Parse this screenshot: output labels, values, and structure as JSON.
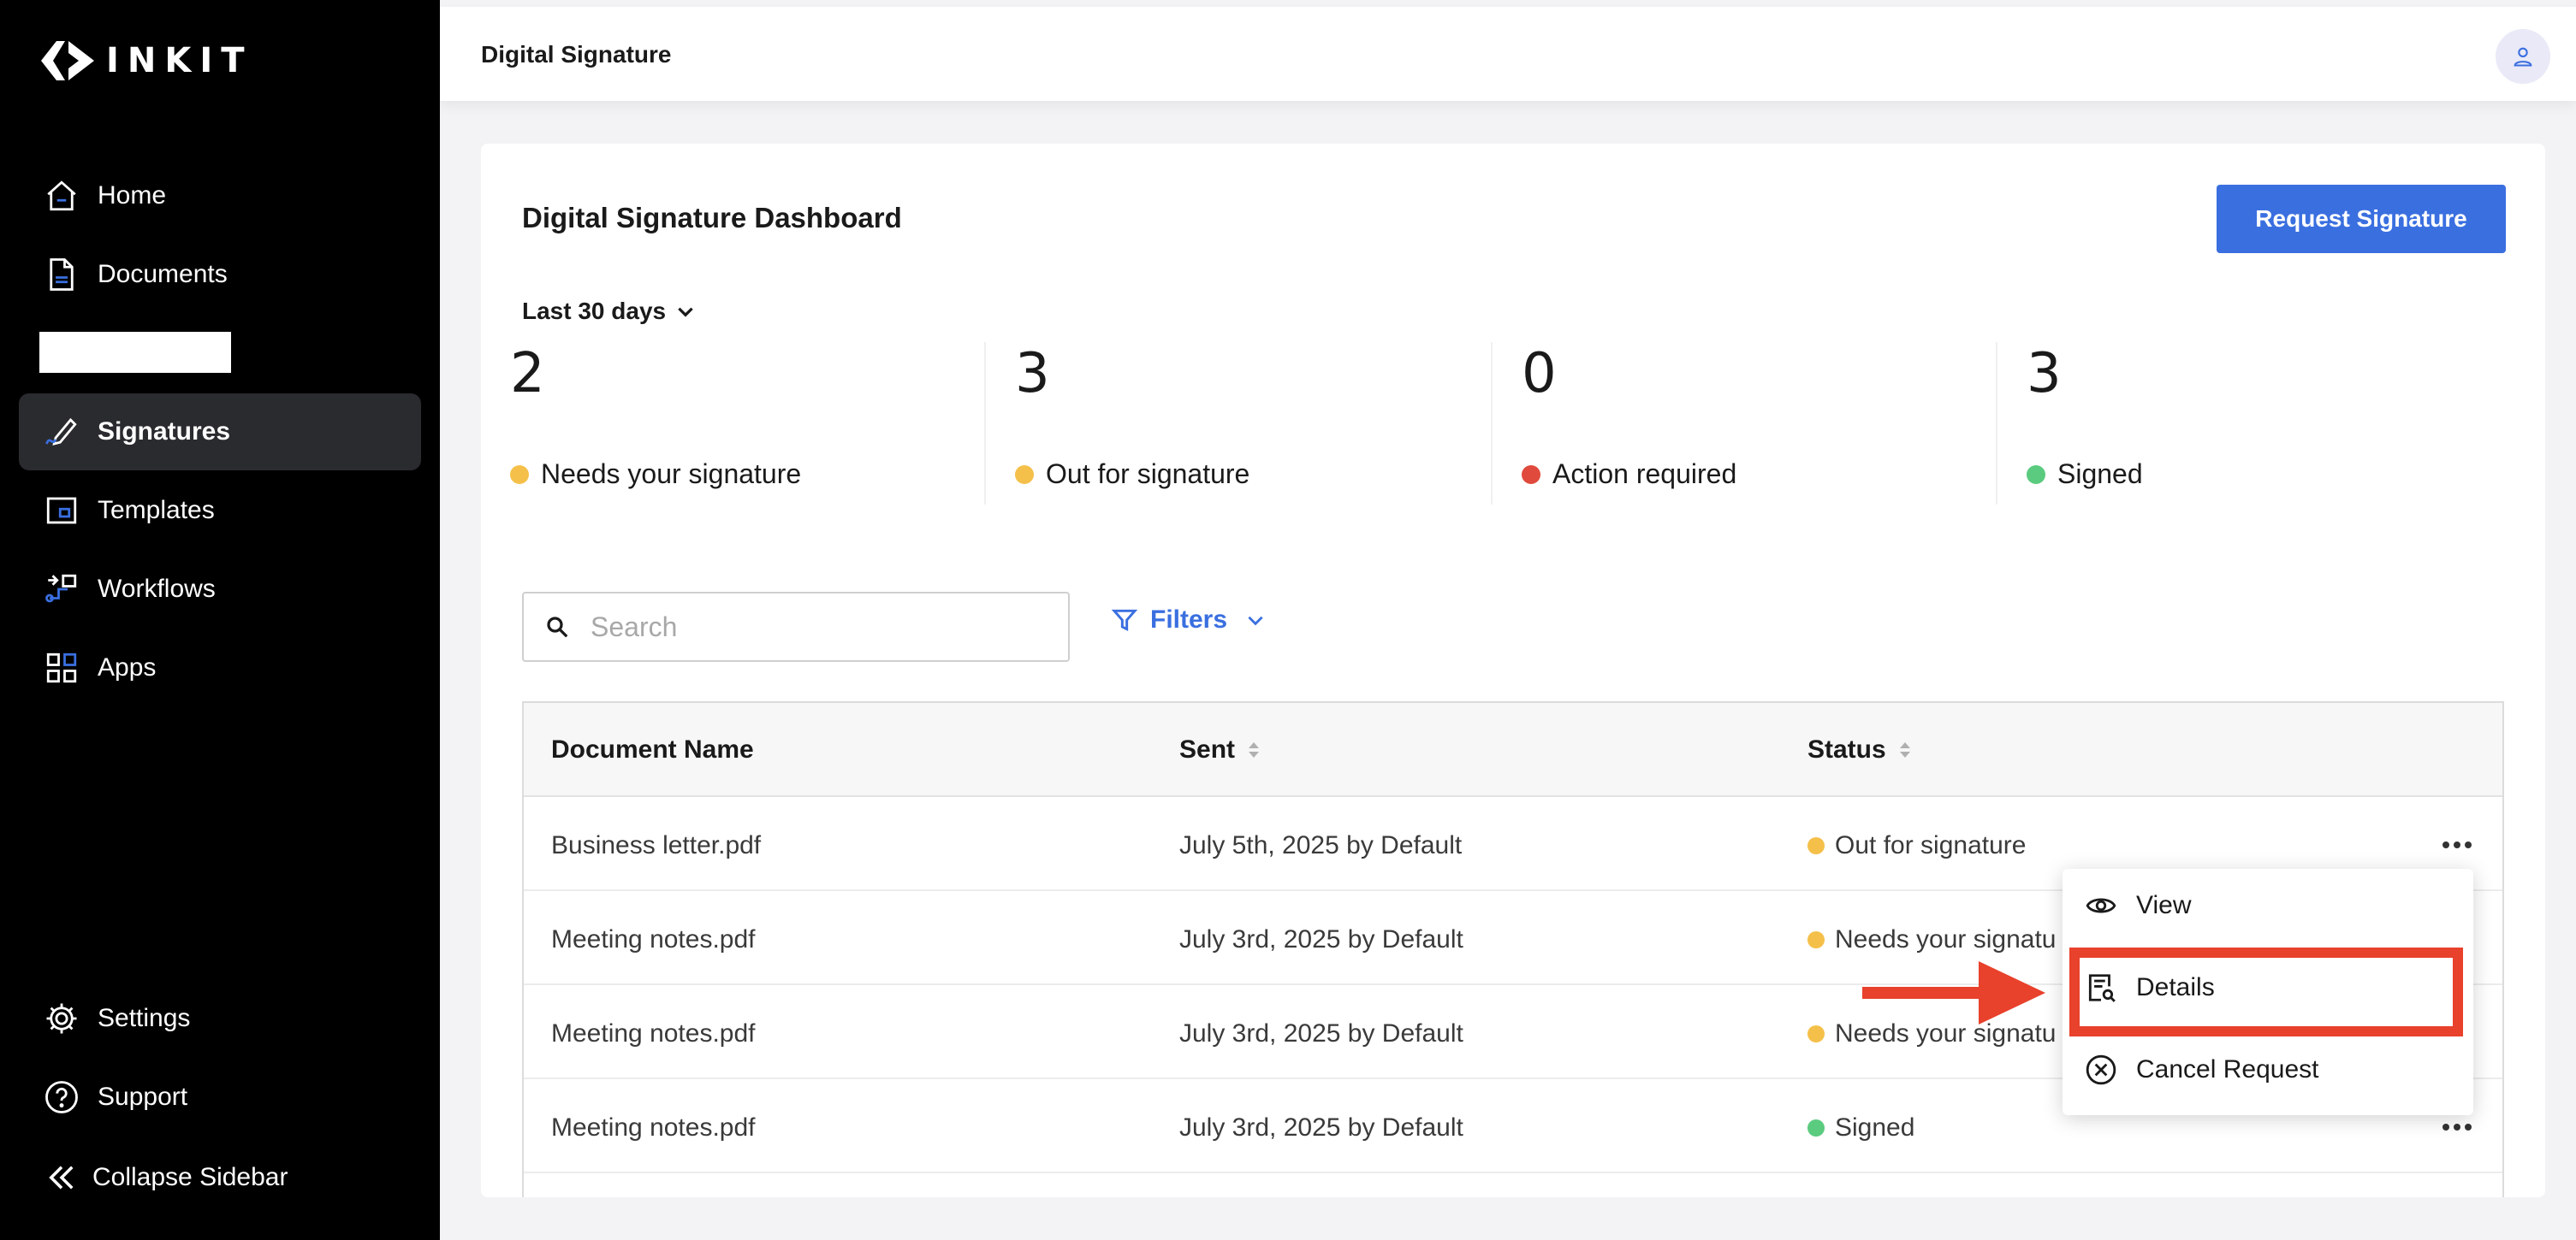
{
  "brand": {
    "name": "INKIT"
  },
  "sidebar": {
    "items": [
      {
        "label": "Home",
        "icon": "home-icon"
      },
      {
        "label": "Documents",
        "icon": "document-icon"
      },
      {
        "label": "Signatures",
        "icon": "signature-icon",
        "active": true
      },
      {
        "label": "Templates",
        "icon": "template-icon"
      },
      {
        "label": "Workflows",
        "icon": "workflow-icon"
      },
      {
        "label": "Apps",
        "icon": "apps-grid-icon"
      }
    ],
    "bottom": [
      {
        "label": "Settings",
        "icon": "gear-icon"
      },
      {
        "label": "Support",
        "icon": "help-icon"
      },
      {
        "label": "Collapse Sidebar",
        "icon": "double-chevron-left-icon"
      }
    ]
  },
  "header": {
    "title": "Digital Signature",
    "avatar_icon": "user-icon"
  },
  "dashboard": {
    "title": "Digital Signature Dashboard",
    "request_button": "Request Signature",
    "date_range": "Last 30 days",
    "stats": [
      {
        "count": "2",
        "label": "Needs your signature",
        "color": "#f5c04a"
      },
      {
        "count": "3",
        "label": "Out for signature",
        "color": "#f5c04a"
      },
      {
        "count": "0",
        "label": "Action required",
        "color": "#e04a3c"
      },
      {
        "count": "3",
        "label": "Signed",
        "color": "#5bcb7f"
      }
    ],
    "search": {
      "placeholder": "Search"
    },
    "filters_label": "Filters"
  },
  "table": {
    "columns": [
      "Document Name",
      "Sent",
      "Status"
    ],
    "rows": [
      {
        "name": "Business letter.pdf",
        "sent": "July 5th, 2025 by Default",
        "status": "Out for signature",
        "status_color": "#f5c04a"
      },
      {
        "name": "Meeting notes.pdf",
        "sent": "July 3rd, 2025 by Default",
        "status": "Needs your signatu",
        "status_color": "#f5c04a"
      },
      {
        "name": "Meeting notes.pdf",
        "sent": "July 3rd, 2025 by Default",
        "status": "Needs your signatu",
        "status_color": "#f5c04a"
      },
      {
        "name": "Meeting notes.pdf",
        "sent": "July 3rd, 2025 by Default",
        "status": "Signed",
        "status_color": "#5bcb7f"
      }
    ]
  },
  "context_menu": {
    "items": [
      {
        "label": "View",
        "icon": "eye-icon"
      },
      {
        "label": "Details",
        "icon": "document-search-icon",
        "highlighted": true
      },
      {
        "label": "Cancel Request",
        "icon": "cancel-circle-icon"
      }
    ]
  },
  "annotation": {
    "color": "#e8412c"
  }
}
